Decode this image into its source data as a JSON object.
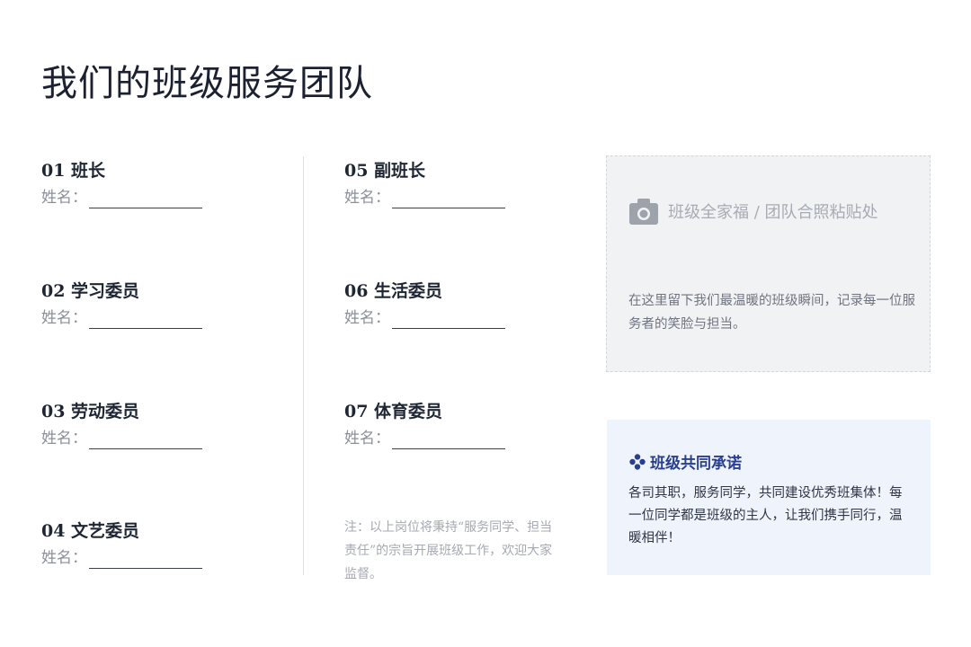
{
  "page": {
    "title": "我们的班级服务团队"
  },
  "roles_left": [
    {
      "title": "01 班长",
      "name_label": "姓名："
    },
    {
      "title": "02 学习委员",
      "name_label": "姓名："
    },
    {
      "title": "03 劳动委员",
      "name_label": "姓名："
    },
    {
      "title": "04 文艺委员",
      "name_label": "姓名："
    }
  ],
  "roles_right": [
    {
      "title": "05 副班长",
      "name_label": "姓名："
    },
    {
      "title": "06 生活委员",
      "name_label": "姓名："
    },
    {
      "title": "07 体育委员",
      "name_label": "姓名："
    }
  ],
  "note": "注：以上岗位将秉持“服务同学、担当责任”的宗旨开展班级工作，欢迎大家监督。",
  "photo": {
    "icon": "camera-icon",
    "title": "班级全家福 / 团队合照粘贴处",
    "description": "在这里留下我们最温暖的班级瞬间，记录每一位服务者的笑脸与担当。"
  },
  "promise": {
    "icon": "flower-icon",
    "title": "班级共同承诺",
    "text": "各司其职，服务同学，共同建设优秀班集体！每一位同学都是班级的主人，让我们携手同行，温暖相伴！"
  },
  "colors": {
    "accent": "#2a3f8e",
    "photo_bg": "#f1f2f4",
    "promise_bg": "#eef3fc"
  }
}
